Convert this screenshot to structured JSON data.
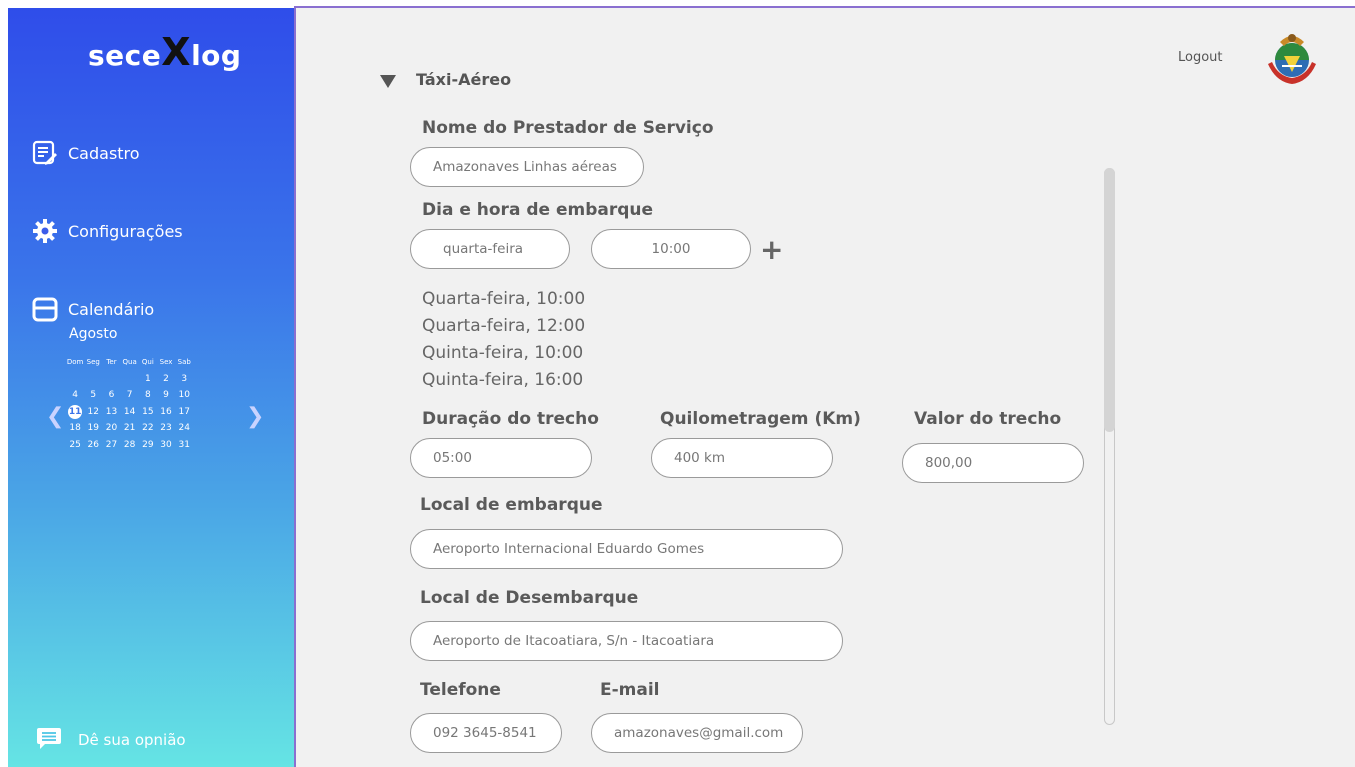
{
  "brand": {
    "pre": "sece",
    "x": "X",
    "post": "log"
  },
  "sidebar": {
    "items": [
      {
        "label": "Cadastro",
        "icon": "form-icon"
      },
      {
        "label": "Configurações",
        "icon": "gear-icon"
      },
      {
        "label": "Calendário",
        "icon": "calendar-icon"
      }
    ],
    "feedback": "Dê sua opnião"
  },
  "calendar": {
    "month": "Agosto",
    "weekdays": [
      "Dom",
      "Seg",
      "Ter",
      "Qua",
      "Qui",
      "Sex",
      "Sab"
    ],
    "weeks": [
      [
        "",
        "",
        "",
        "",
        "",
        "1",
        "2",
        "3"
      ],
      [
        "4",
        "5",
        "6",
        "7",
        "8",
        "9",
        "10"
      ],
      [
        "11",
        "12",
        "13",
        "14",
        "15",
        "16",
        "17"
      ],
      [
        "18",
        "19",
        "20",
        "21",
        "22",
        "23",
        "24"
      ],
      [
        "25",
        "26",
        "27",
        "28",
        "29",
        "30",
        "31"
      ]
    ],
    "today": "11"
  },
  "header": {
    "logout": "Logout"
  },
  "form": {
    "section": "Táxi-Aéreo",
    "provider_label": "Nome do Prestador de Serviço",
    "provider_value": "Amazonaves  Linhas aéreas",
    "boarding_label": "Dia e hora de embarque",
    "day_value": "quarta-feira",
    "time_value": "10:00",
    "schedules": [
      "Quarta-feira, 10:00",
      "Quarta-feira, 12:00",
      "Quinta-feira, 10:00",
      "Quinta-feira, 16:00"
    ],
    "duration_label": "Duração do trecho",
    "duration_value": "05:00",
    "km_label": "Quilometragem (Km)",
    "km_value": "400 km",
    "price_label": "Valor do trecho",
    "price_value": "800,00",
    "origin_label": "Local de embarque",
    "origin_value": "Aeroporto Internacional Eduardo Gomes",
    "dest_label": "Local de Desembarque",
    "dest_value": "Aeroporto de Itacoatiara, S/n - Itacoatiara",
    "phone_label": "Telefone",
    "phone_value": "092 3645-8541",
    "email_label": "E-mail",
    "email_value": "amazonaves@gmail.com"
  }
}
